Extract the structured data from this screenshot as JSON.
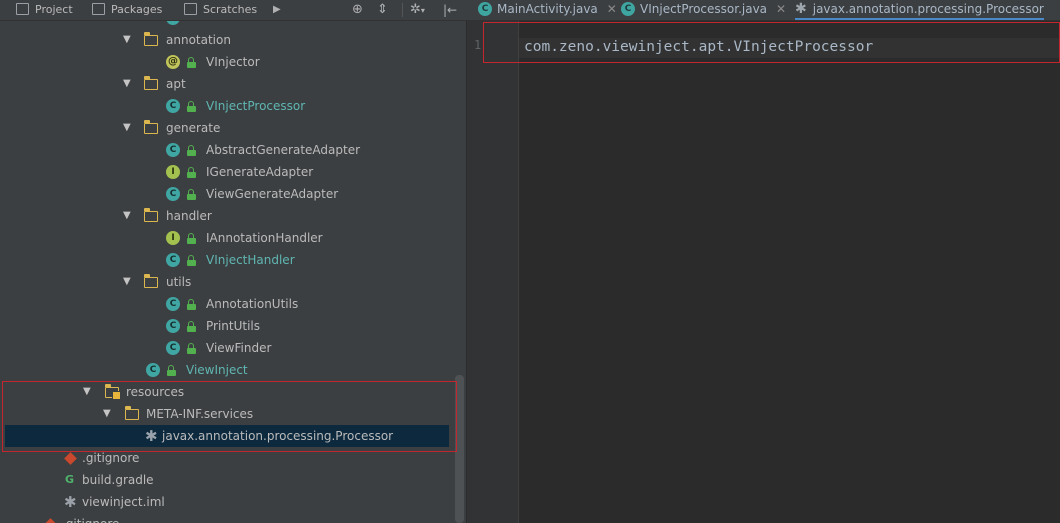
{
  "tool_window_tabs": {
    "project": "Project",
    "packages": "Packages",
    "scratches": "Scratches"
  },
  "editor_tabs": [
    {
      "label": "MainActivity.java",
      "kind": "class"
    },
    {
      "label": "VInjectProcessor.java",
      "kind": "class"
    },
    {
      "label": "javax.annotation.processing.Processor",
      "kind": "file",
      "active": true
    }
  ],
  "tree": {
    "folders": {
      "annotation": "annotation",
      "apt": "apt",
      "generate": "generate",
      "handler": "handler",
      "utils": "utils",
      "resources": "resources",
      "meta_inf": "META-INF.services"
    },
    "files": {
      "vinjector": "VInjector",
      "vinject_processor": "VInjectProcessor",
      "abstract_generate_adapter": "AbstractGenerateAdapter",
      "igenerate_adapter": "IGenerateAdapter",
      "view_generate_adapter": "ViewGenerateAdapter",
      "iannotation_handler": "IAnnotationHandler",
      "vinject_handler": "VInjectHandler",
      "annotation_utils": "AnnotationUtils",
      "print_utils": "PrintUtils",
      "view_finder": "ViewFinder",
      "view_inject": "ViewInject",
      "processor_file": "javax.annotation.processing.Processor",
      "gitignore": ".gitignore",
      "build_gradle": "build.gradle",
      "viewinject_iml": "viewinject.iml",
      "gitignore_root": ".gitignore"
    },
    "badges": {
      "class": "C",
      "interface": "I",
      "annotation": "@"
    }
  },
  "editor": {
    "line_number": "1",
    "line_1": "com.zeno.viewinject.apt.VInjectProcessor"
  },
  "colors": {
    "highlight_box": "#c3262f",
    "selection": "#0d293e",
    "class_badge": "#40a6a3",
    "interface_badge": "#a3c14e",
    "folder": "#dcb64f"
  }
}
